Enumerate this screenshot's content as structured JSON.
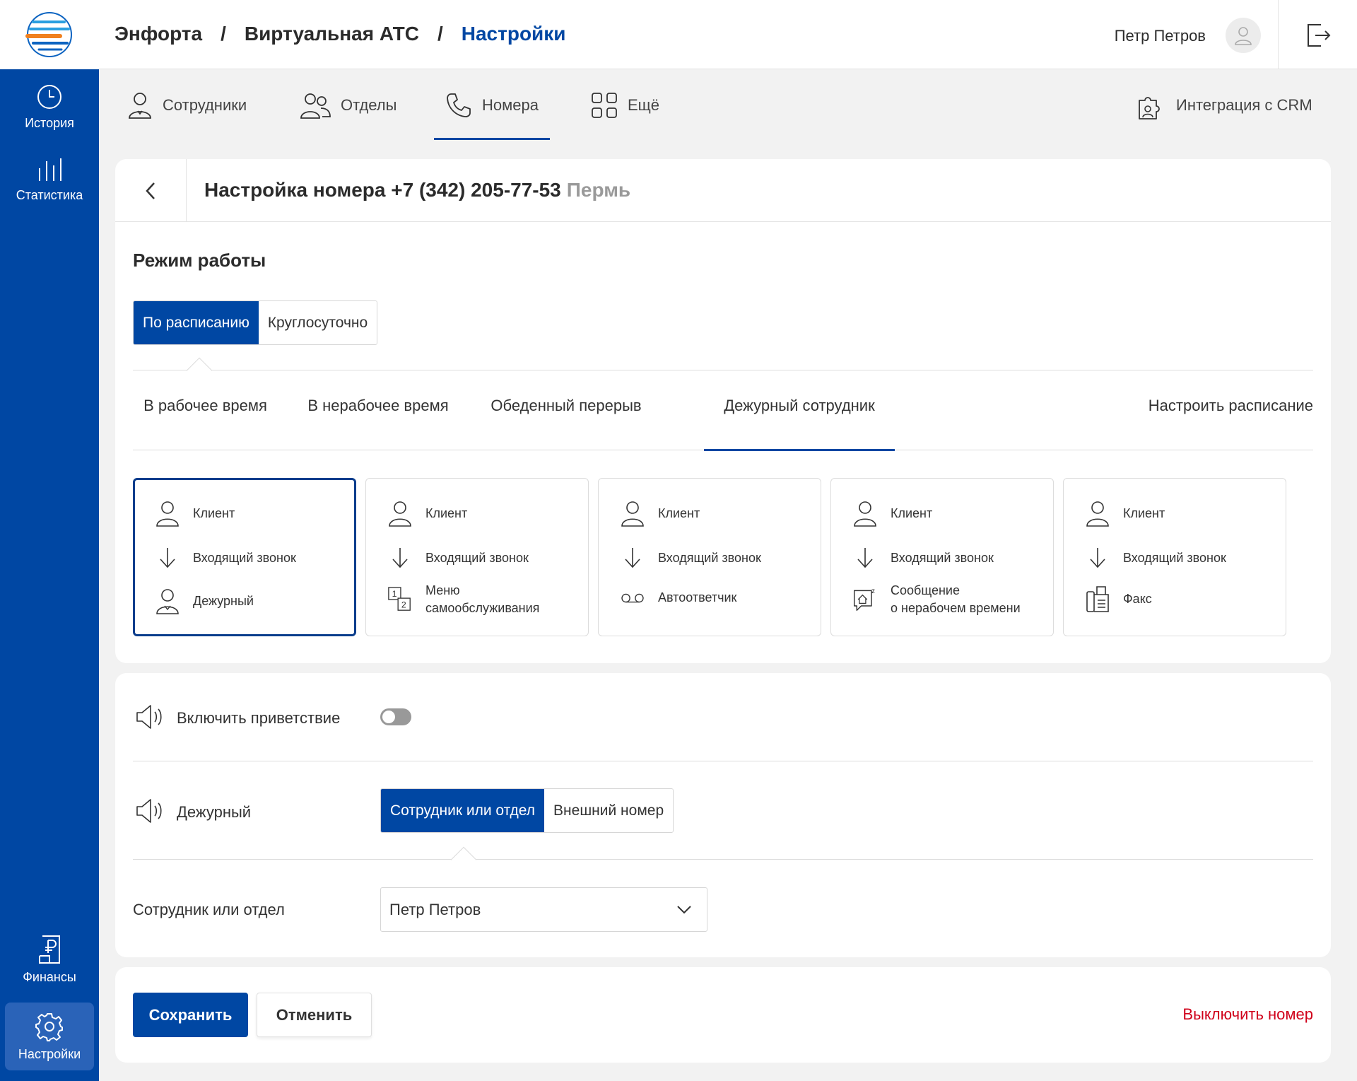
{
  "sidebar": {
    "items": [
      {
        "label": "История",
        "icon": "clock-icon"
      },
      {
        "label": "Статистика",
        "icon": "bar-chart-icon"
      },
      {
        "label": "Финансы",
        "icon": "ruble-doc-icon"
      },
      {
        "label": "Настройки",
        "icon": "gear-icon"
      }
    ]
  },
  "header": {
    "breadcrumb": [
      "Энфорта",
      "Виртуальная АТС",
      "Настройки"
    ],
    "separator": "/",
    "user_name": "Петр Петров"
  },
  "nav": {
    "tabs": [
      {
        "label": "Сотрудники",
        "icon": "employee-icon"
      },
      {
        "label": "Отделы",
        "icon": "departments-icon"
      },
      {
        "label": "Номера",
        "icon": "phone-icon",
        "active": true
      },
      {
        "label": "Ещё",
        "icon": "grid-icon"
      }
    ],
    "crm": {
      "label": "Интеграция с CRM",
      "icon": "puzzle-user-icon"
    }
  },
  "page": {
    "title": "Настройка номера +7 (342) 205-77-53",
    "city": "Пермь"
  },
  "mode": {
    "title": "Режим работы",
    "options": [
      "По расписанию",
      "Круглосуточно"
    ],
    "selected": "По расписанию"
  },
  "schedule_tabs": {
    "items": [
      "В рабочее время",
      "В нерабочее время",
      "Обеденный перерыв",
      "Дежурный сотрудник"
    ],
    "active": "Дежурный сотрудник",
    "configure": "Настроить расписание"
  },
  "routes": [
    {
      "client": "Клиент",
      "call": "Входящий звонок",
      "target": "Дежурный",
      "target_icon": "duty-person-icon",
      "selected": true
    },
    {
      "client": "Клиент",
      "call": "Входящий звонок",
      "target": "Меню",
      "target2": "самообслуживания",
      "target_icon": "ivr-menu-icon"
    },
    {
      "client": "Клиент",
      "call": "Входящий звонок",
      "target": "Автоответчик",
      "target_icon": "voicemail-icon"
    },
    {
      "client": "Клиент",
      "call": "Входящий звонок",
      "target": "Сообщение",
      "target2": "о нерабочем времени",
      "target_icon": "off-hours-message-icon"
    },
    {
      "client": "Клиент",
      "call": "Входящий звонок",
      "target": "Факс",
      "target_icon": "fax-icon"
    }
  ],
  "greeting": {
    "label": "Включить приветствие",
    "enabled": false
  },
  "duty": {
    "label": "Дежурный",
    "options": [
      "Сотрудник или отдел",
      "Внешний номер"
    ],
    "selected": "Сотрудник или отдел"
  },
  "employee": {
    "label": "Сотрудник или отдел",
    "value": "Петр Петров"
  },
  "actions": {
    "save": "Сохранить",
    "cancel": "Отменить",
    "disable": "Выключить номер"
  },
  "colors": {
    "brand": "#0047a3",
    "danger": "#d0021b",
    "sidebar": "#0047a3"
  }
}
